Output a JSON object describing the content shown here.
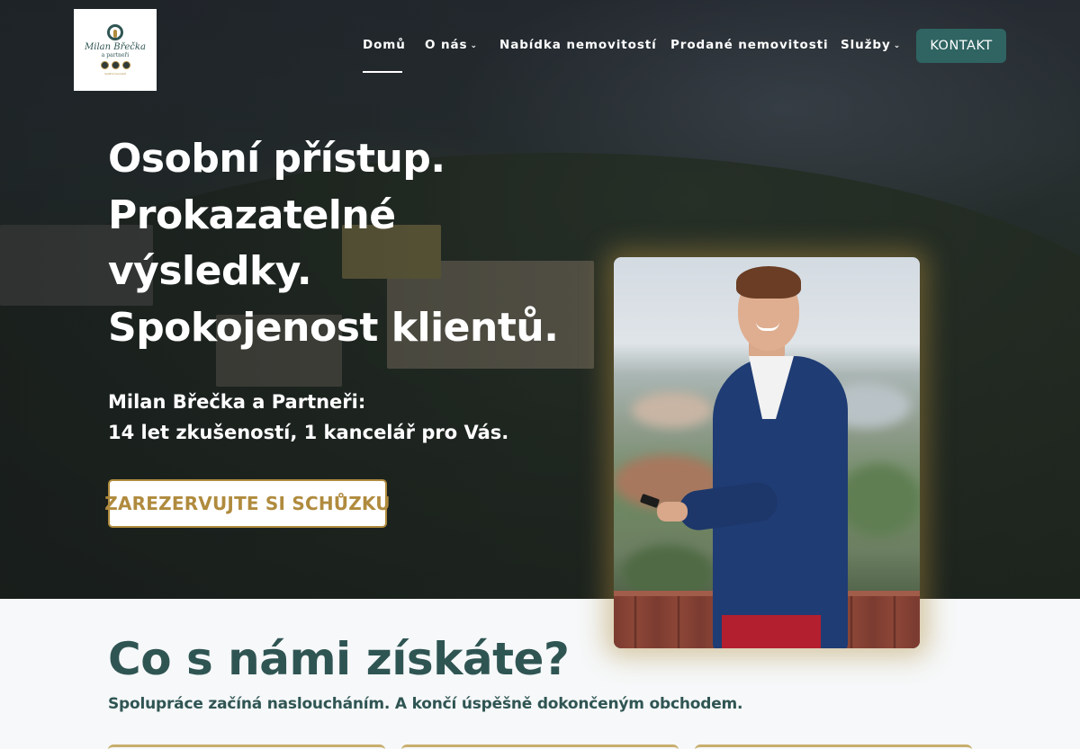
{
  "brand": {
    "logo_name": "Milan Břečka",
    "logo_sub": "a partneři",
    "logo_tagline": "realitní kancelář",
    "colors": {
      "primary": "#2f5553",
      "accent": "#b08b3e",
      "button": "#2f6462"
    }
  },
  "nav": {
    "items": [
      {
        "label": "Domů",
        "active": true,
        "dropdown": false
      },
      {
        "label": "O nás",
        "active": false,
        "dropdown": true
      },
      {
        "label": "Nabídka nemovitostí",
        "active": false,
        "dropdown": false
      },
      {
        "label": "Prodané nemovitosti",
        "active": false,
        "dropdown": false
      },
      {
        "label": "Služby",
        "active": false,
        "dropdown": true
      }
    ],
    "contact_label": "KONTAKT",
    "dropdown_icon": "chevron-down-icon"
  },
  "hero": {
    "headline": [
      "Osobní přístup.",
      "Prokazatelné",
      "výsledky.",
      "Spokojenost klientů."
    ],
    "subline": [
      "Milan Břečka a Partneři:",
      "14 let zkušeností, 1 kancelář pro Vás."
    ],
    "cta_label": "ZAREZERVUJTE SI SCHŮZKU"
  },
  "section": {
    "title": "Co s námi získáte?",
    "subtitle": "Spolupráce začíná nasloucháním. A končí úspěšně dokončeným obchodem."
  }
}
